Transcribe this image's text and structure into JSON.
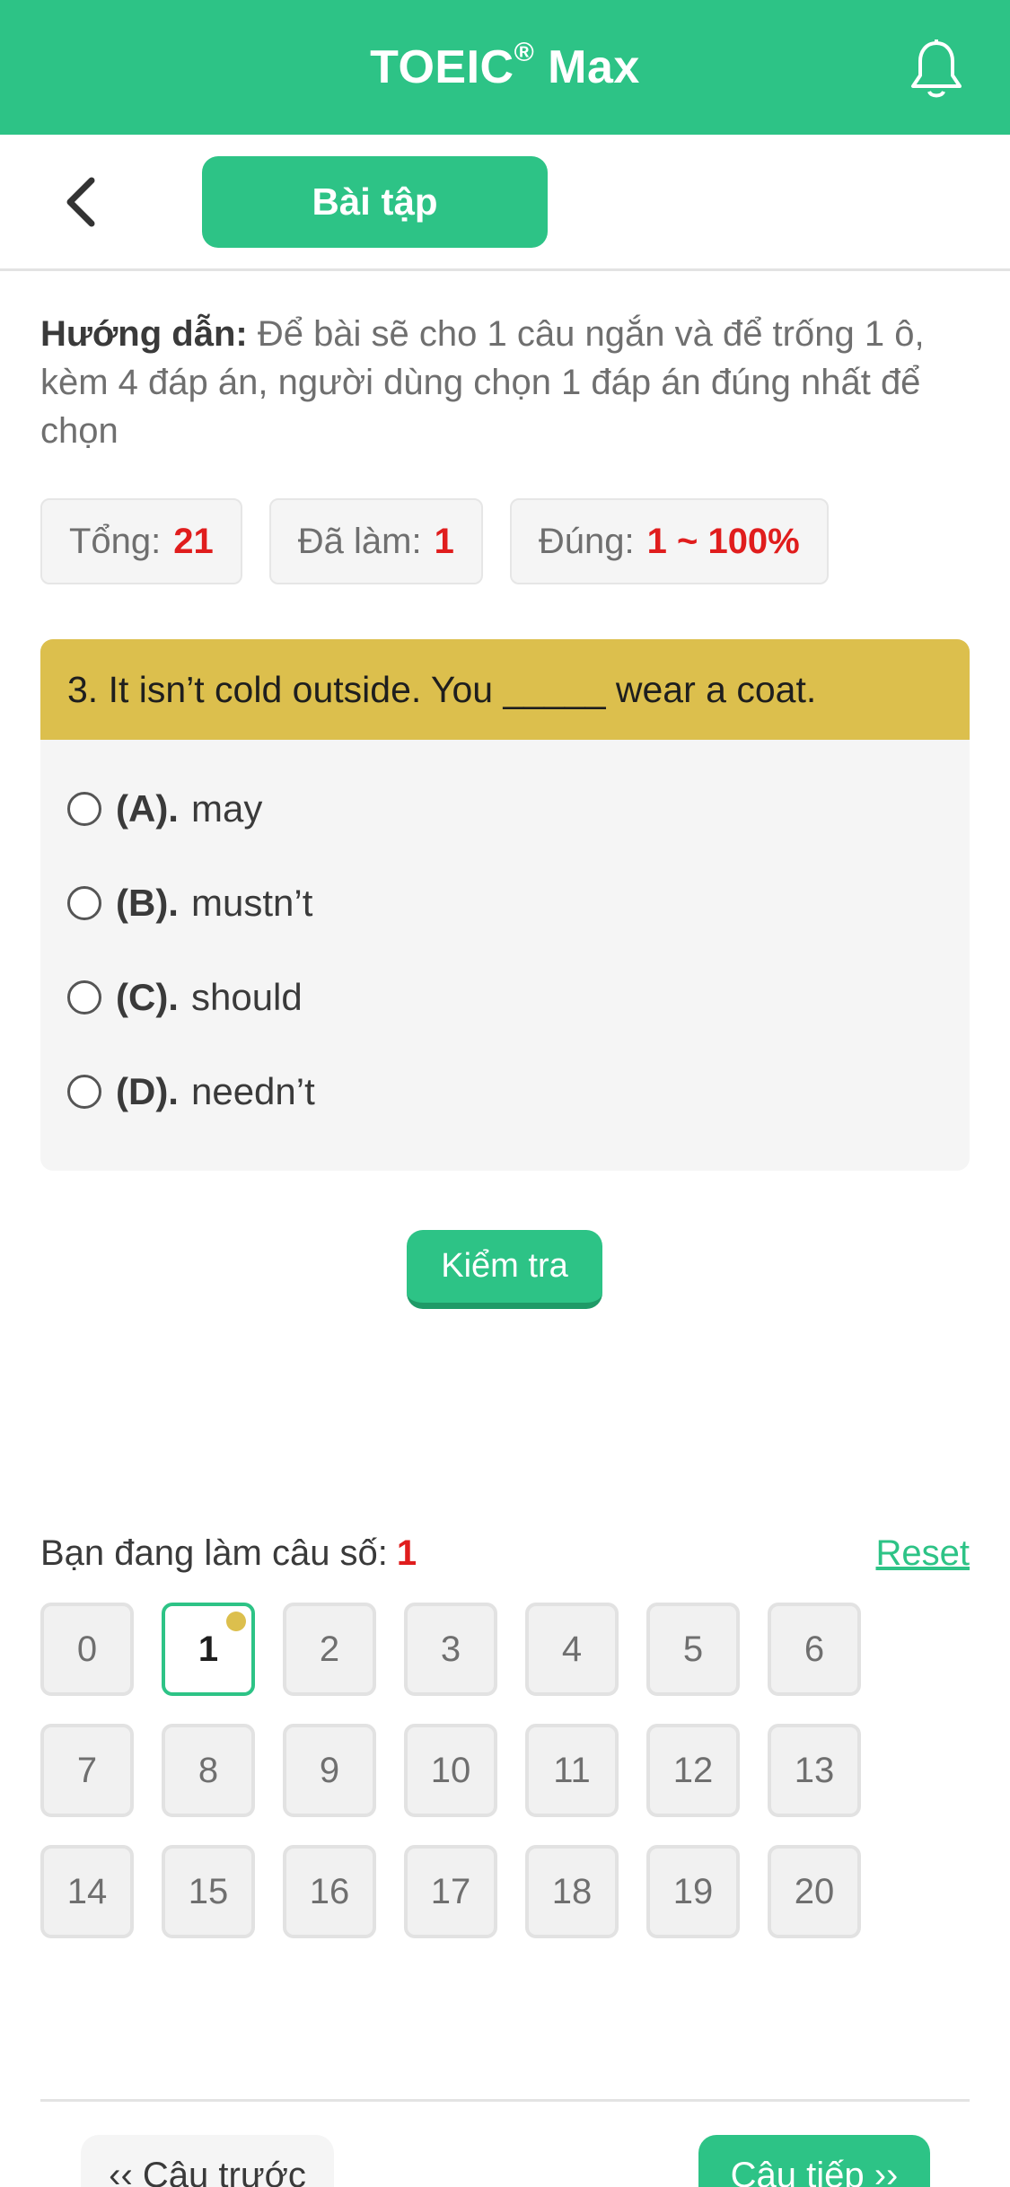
{
  "appbar": {
    "title": "TOEIC",
    "title_mark": "®",
    "title_suffix": " Max",
    "bell_icon": "bell-icon",
    "accent_color": "#2dc386"
  },
  "subheader": {
    "back_icon": "chevron-left-icon",
    "tab_label": "Bài tập"
  },
  "instructions": {
    "label": "Hướng dẫn:",
    "text": " Để bài sẽ cho 1 câu ngắn và để trống 1 ô, kèm 4 đáp án, người dùng chọn 1 đáp án đúng nhất để chọn"
  },
  "stats": {
    "total_label": "Tổng:",
    "total_value": "21",
    "done_label": "Đã làm:",
    "done_value": "1",
    "correct_label": "Đúng:",
    "correct_value": "1 ~ 100%"
  },
  "question": {
    "text": "3. It isn’t cold outside. You _____ wear a coat.",
    "header_color": "#dcbf4d",
    "options": [
      {
        "letter": "(A).",
        "text": "may"
      },
      {
        "letter": "(B).",
        "text": "mustn’t"
      },
      {
        "letter": "(C).",
        "text": "should"
      },
      {
        "letter": "(D).",
        "text": "needn’t"
      }
    ]
  },
  "check_button": "Kiểm tra",
  "progress": {
    "label": "Bạn đang làm câu số:",
    "current": "1",
    "reset": "Reset"
  },
  "numbers": [
    "0",
    "1",
    "2",
    "3",
    "4",
    "5",
    "6",
    "7",
    "8",
    "9",
    "10",
    "11",
    "12",
    "13",
    "14",
    "15",
    "16",
    "17",
    "18",
    "19",
    "20"
  ],
  "active_number": "1",
  "nav": {
    "prev": "‹‹ Câu trước",
    "next": "Câu tiếp ››"
  }
}
